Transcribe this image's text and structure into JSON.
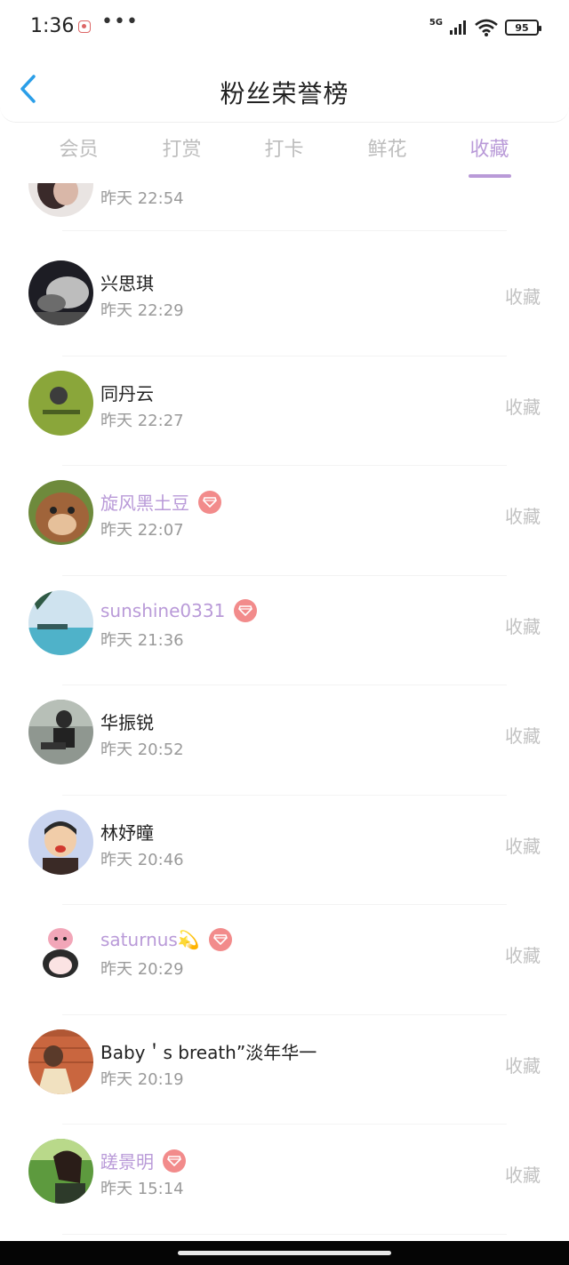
{
  "status_bar": {
    "time": "1:36",
    "dots": "•••",
    "network": "5G",
    "battery": "95"
  },
  "header": {
    "title": "粉丝荣誉榜"
  },
  "tabs": [
    {
      "label": "会员",
      "active": false
    },
    {
      "label": "打赏",
      "active": false
    },
    {
      "label": "打卡",
      "active": false
    },
    {
      "label": "鲜花",
      "active": false
    },
    {
      "label": "收藏",
      "active": true
    }
  ],
  "colors": {
    "accent": "#b99ad8",
    "vip_badge": "#f28b8b",
    "back_arrow": "#2a9ee8"
  },
  "list": {
    "partial_top_time": "昨天 22:54",
    "items": [
      {
        "name": "兴思琪",
        "time": "昨天 22:29",
        "action": "收藏",
        "vip": false,
        "avatar": "avatar-bw-portrait"
      },
      {
        "name": "同丹云",
        "time": "昨天 22:27",
        "action": "收藏",
        "vip": false,
        "avatar": "avatar-green-logo"
      },
      {
        "name": "旋风黑土豆",
        "time": "昨天 22:07",
        "action": "收藏",
        "vip": true,
        "avatar": "avatar-cartoon-bear"
      },
      {
        "name": "sunshine0331",
        "time": "昨天 21:36",
        "action": "收藏",
        "vip": true,
        "avatar": "avatar-sea-landscape"
      },
      {
        "name": "华振锐",
        "time": "昨天 20:52",
        "action": "收藏",
        "vip": false,
        "avatar": "avatar-sitting-man"
      },
      {
        "name": "林妤瞳",
        "time": "昨天 20:46",
        "action": "收藏",
        "vip": false,
        "avatar": "avatar-child"
      },
      {
        "name": "saturnus💫",
        "time": "昨天 20:29",
        "action": "收藏",
        "vip": true,
        "avatar": "avatar-pig-cartoon"
      },
      {
        "name": "Baby＇s breath”淡年华一",
        "time": "昨天 20:19",
        "action": "收藏",
        "vip": false,
        "avatar": "avatar-brick-wall"
      },
      {
        "name": "蹉景明",
        "time": "昨天 15:14",
        "action": "收藏",
        "vip": true,
        "avatar": "avatar-woman-green"
      }
    ]
  }
}
